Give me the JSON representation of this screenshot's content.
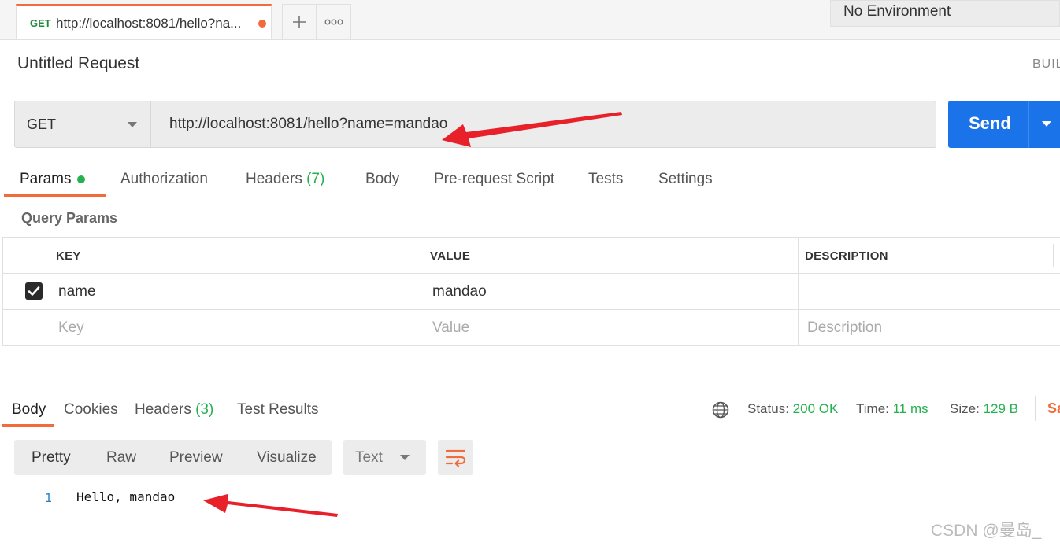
{
  "top_tab": {
    "method": "GET",
    "url": "http://localhost:8081/hello?na..."
  },
  "environment": {
    "selected": "No Environment"
  },
  "request": {
    "title": "Untitled Request",
    "build_label": "BUIL",
    "method": "GET",
    "url": "http://localhost:8081/hello?name=mandao",
    "send_label": "Send"
  },
  "request_tabs": {
    "params": "Params",
    "authorization": "Authorization",
    "headers": "Headers",
    "headers_count": "(7)",
    "body": "Body",
    "prerequest": "Pre-request Script",
    "tests": "Tests",
    "settings": "Settings"
  },
  "query_params": {
    "title": "Query Params",
    "headers": {
      "key": "KEY",
      "value": "VALUE",
      "description": "DESCRIPTION"
    },
    "rows": [
      {
        "key": "name",
        "value": "mandao",
        "description": "",
        "checked": true
      }
    ],
    "placeholders": {
      "key": "Key",
      "value": "Value",
      "description": "Description"
    }
  },
  "response": {
    "tabs": {
      "body": "Body",
      "cookies": "Cookies",
      "headers": "Headers",
      "headers_count": "(3)",
      "test_results": "Test Results"
    },
    "status_label": "Status:",
    "status_value": "200 OK",
    "time_label": "Time:",
    "time_value": "11 ms",
    "size_label": "Size:",
    "size_value": "129 B",
    "save_label": "Sa",
    "format_tabs": [
      "Pretty",
      "Raw",
      "Preview",
      "Visualize"
    ],
    "format_type": "Text",
    "lines": [
      {
        "number": "1",
        "text": "Hello, mandao"
      }
    ]
  },
  "watermark": "CSDN @曼岛_",
  "colors": {
    "accent": "#f26b3a",
    "send": "#1a73e8",
    "success": "#26b150",
    "annotation_arrow": "#e8202a"
  },
  "icons": [
    "plus-icon",
    "more-icon",
    "caret-down-icon",
    "globe-icon",
    "wrap-lines-icon",
    "checkbox-checked-icon"
  ]
}
